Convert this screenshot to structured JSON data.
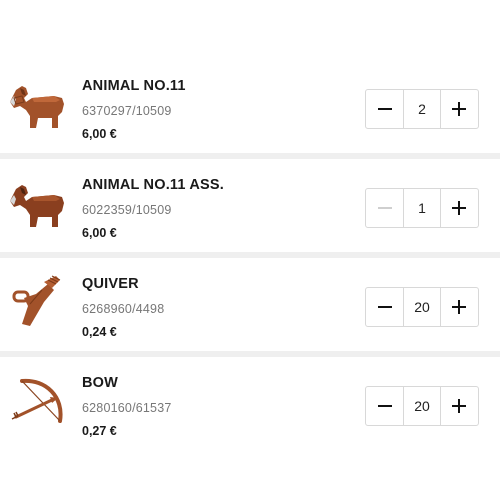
{
  "colors": {
    "brick": "#a2522a",
    "separator": "#efefef",
    "disabled": "#cfcfcf"
  },
  "items": [
    {
      "name": "ANIMAL NO.11",
      "code": "6370297/10509",
      "price": "6,00 €",
      "quantity": "2",
      "image_icon": "horse-icon",
      "minus_enabled": true
    },
    {
      "name": "ANIMAL NO.11 ASS.",
      "code": "6022359/10509",
      "price": "6,00 €",
      "quantity": "1",
      "image_icon": "horse-icon",
      "minus_enabled": false
    },
    {
      "name": "QUIVER",
      "code": "6268960/4498",
      "price": "0,24 €",
      "quantity": "20",
      "image_icon": "quiver-icon",
      "minus_enabled": true
    },
    {
      "name": "BOW",
      "code": "6280160/61537",
      "price": "0,27 €",
      "quantity": "20",
      "image_icon": "bow-icon",
      "minus_enabled": true
    }
  ]
}
